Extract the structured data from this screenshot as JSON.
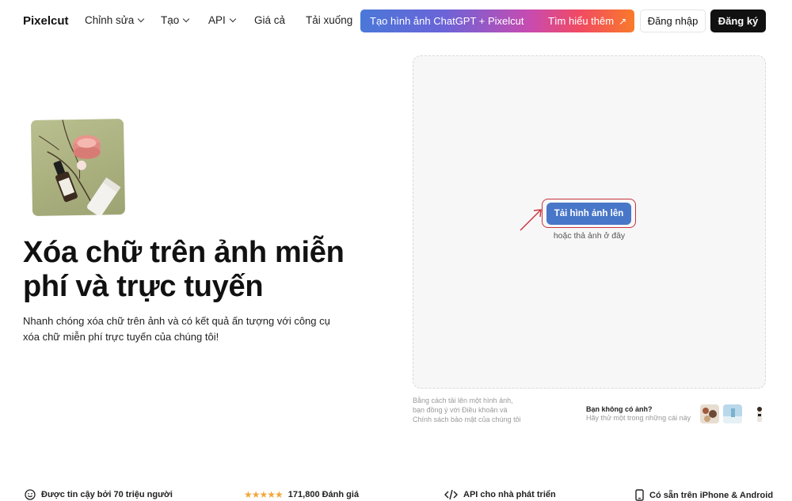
{
  "nav": {
    "logo": "Pixelcut",
    "items": [
      {
        "label": "Chỉnh sửa",
        "dropdown": true
      },
      {
        "label": "Tạo",
        "dropdown": true
      },
      {
        "label": "API",
        "dropdown": true
      },
      {
        "label": "Giá cả",
        "dropdown": false
      },
      {
        "label": "Tải xuống",
        "dropdown": false
      }
    ],
    "promo_text": "Tạo hình ảnh ChatGPT + Pixelcut",
    "promo_link": "Tìm hiểu thêm",
    "promo_arrow_icon": "arrow-up-right-icon",
    "login": "Đăng nhập",
    "signup": "Đăng ký"
  },
  "hero": {
    "title": "Xóa chữ trên ảnh miễn phí và trực tuyến",
    "description": "Nhanh chóng xóa chữ trên ảnh và có kết quả ấn tượng với công cụ xóa chữ miễn phí trực tuyến của chúng tôi!"
  },
  "upload": {
    "button": "Tải hình ảnh lên",
    "hint": "hoặc thả ảnh ở đây",
    "terms": "Bằng cách tải lên một hình ảnh, bạn đồng ý với Điều khoản và Chính sách bảo mật của chúng tôi",
    "no_image_title": "Bạn không có ảnh?",
    "no_image_sub": "Hãy thử một trong những cái này"
  },
  "features": {
    "trusted": "Được tin cậy bởi 70 triệu người",
    "stars": "★★★★★",
    "rating": "171,800 Đánh giá",
    "api": "API cho nhà phát triển",
    "mobile": "Có sẵn trên iPhone & Android"
  },
  "colors": {
    "primary_button": "#4876c8",
    "highlight": "#c8333b",
    "star": "#f2a73b"
  }
}
